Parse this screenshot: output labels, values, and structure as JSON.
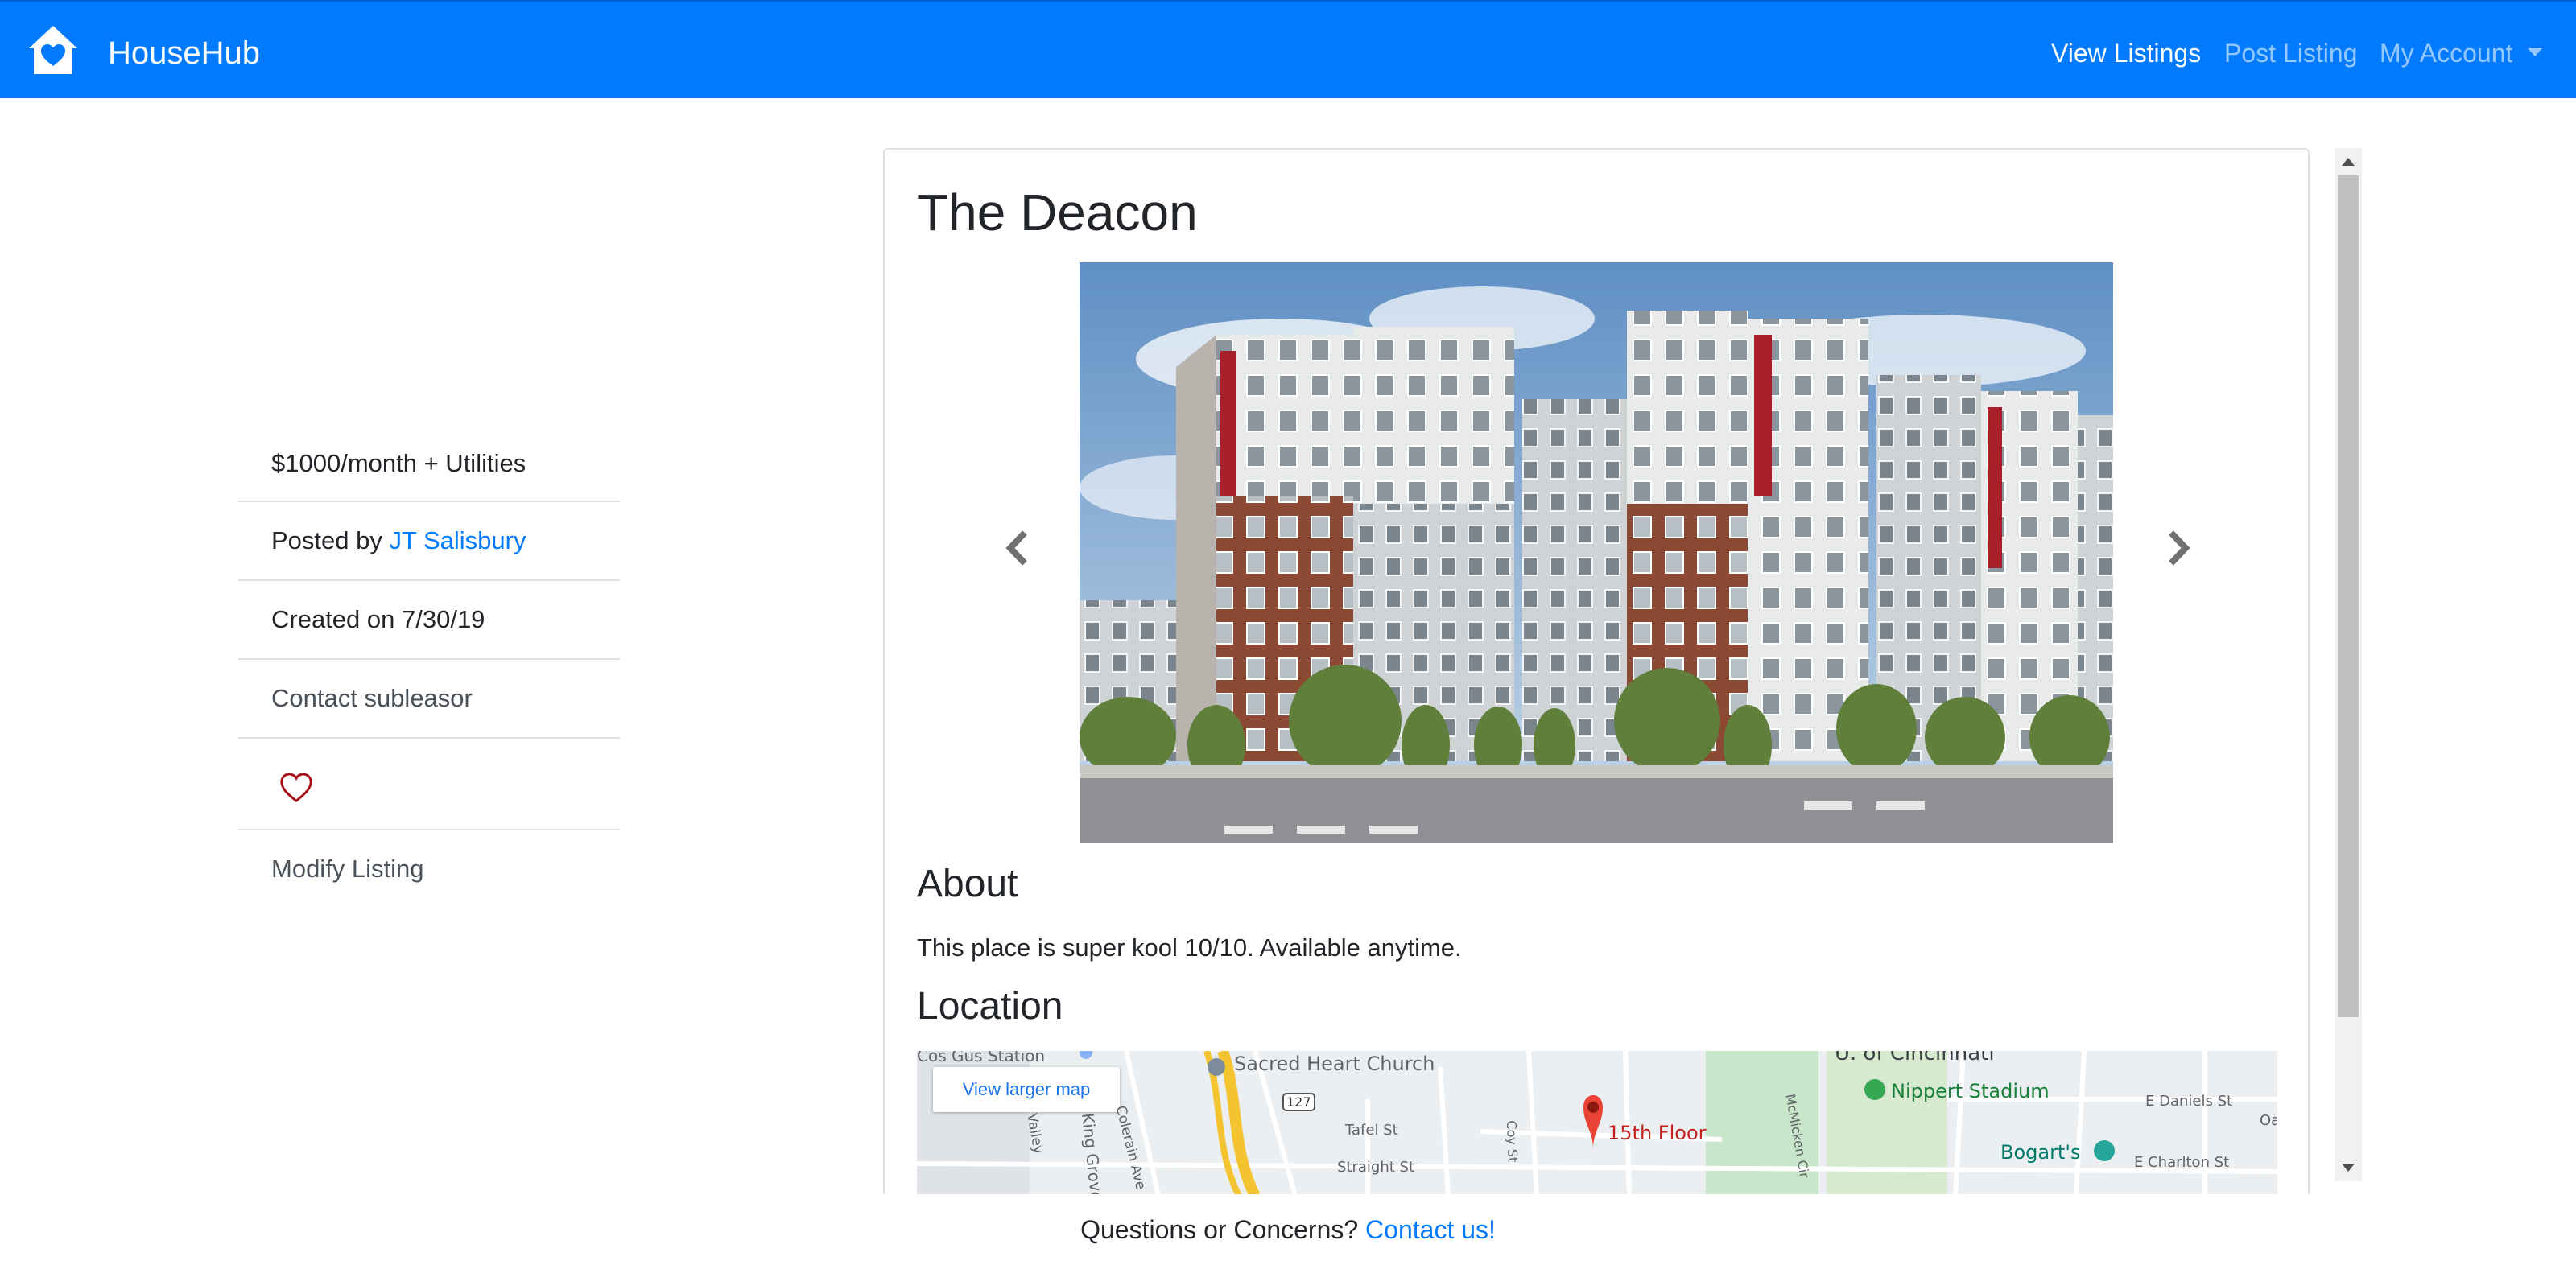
{
  "navbar": {
    "brand": "HouseHub",
    "links": [
      "View Listings",
      "Post Listing",
      "My Account"
    ],
    "colors": {
      "background": "#007bff",
      "active_link": "#ffffff"
    },
    "logo_icon": "house-heart-icon"
  },
  "listing": {
    "title": "The Deacon",
    "price": "$1000/month + Utilities",
    "posted_prefix": "Posted by ",
    "posted_by": "JT Salisbury",
    "created": "Created on 7/30/19",
    "contact": "Contact subleasor",
    "favorite_icon": "heart-outline-icon",
    "modify": "Modify Listing",
    "about_heading": "About",
    "about_text": "This place is super kool 10/10. Available anytime.",
    "location_heading": "Location"
  },
  "carousel": {
    "prev_icon": "chevron-left-icon",
    "next_icon": "chevron-right-icon"
  },
  "map": {
    "button": "View larger map",
    "labels": {
      "station": "Cos Gus Station",
      "church": "Sacred Heart Church",
      "route": "127",
      "tafel": "Tafel St",
      "straight": "Straight St",
      "colerain": "Colerain Ave",
      "valley": "Valley",
      "king": "King Grove",
      "coy": "Coy St",
      "mcmicken": "McMicken Cir",
      "marker": "15th Floor",
      "university": "U. of Cincinnati",
      "stadium": "Nippert Stadium",
      "daniels": "E Daniels St",
      "bogarts": "Bogart's",
      "charlton": "E Charlton St",
      "oak": "Oa"
    }
  },
  "footer": {
    "text": "Questions or Concerns? ",
    "link": "Contact us!"
  }
}
